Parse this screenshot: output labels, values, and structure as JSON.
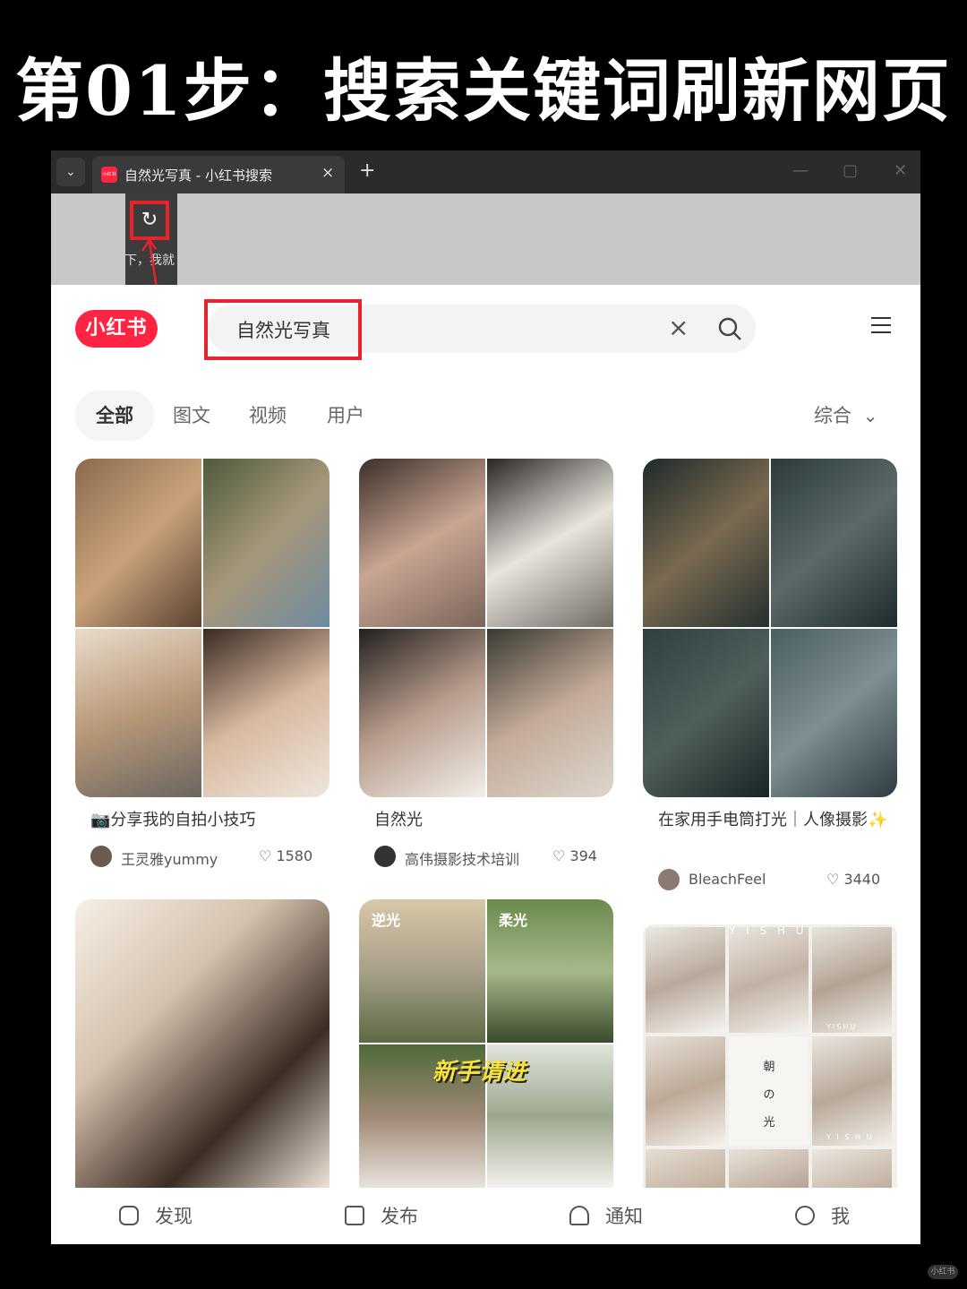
{
  "headline": "第01步：搜索关键词刷新网页",
  "browser": {
    "tab_title": "自然光写真 - 小红书搜索",
    "favicon_text": "小红书",
    "tab_close": "×",
    "new_tab": "+",
    "dropdown": "⌄",
    "min": "—",
    "max": "▢",
    "close": "✕",
    "reload_icon": "↻",
    "strip_text": "下，我就"
  },
  "app": {
    "logo": "小红书",
    "search_value": "自然光写真",
    "clear_icon": "×",
    "filters": [
      "全部",
      "图文",
      "视频",
      "用户"
    ],
    "active_filter": 0,
    "sort_label": "综合",
    "sort_chevron": "⌄",
    "accent": "#ff2442",
    "highlight": "#e8232b"
  },
  "cards": [
    {
      "title": "📷分享我的自拍小技巧",
      "author": "王灵雅yummy",
      "likes": "1580"
    },
    {
      "title": "自然光",
      "author": "高伟摄影技术培训",
      "likes": "394"
    },
    {
      "title": "在家用手电筒打光｜人像摄影✨",
      "author": "BleachFeel",
      "likes": "3440"
    }
  ],
  "card_overlays": {
    "c5_tl": "逆光",
    "c5_tr": "柔光",
    "c5_center": "新手请进",
    "c6_top": "Y I S H U",
    "c6_center": "朝 の 光",
    "c6_tag1": "YISHU",
    "c6_tag2": "Y I S H U"
  },
  "nav": [
    "发现",
    "发布",
    "通知",
    "我"
  ],
  "like_icon": "♡",
  "watermark": "小红书"
}
